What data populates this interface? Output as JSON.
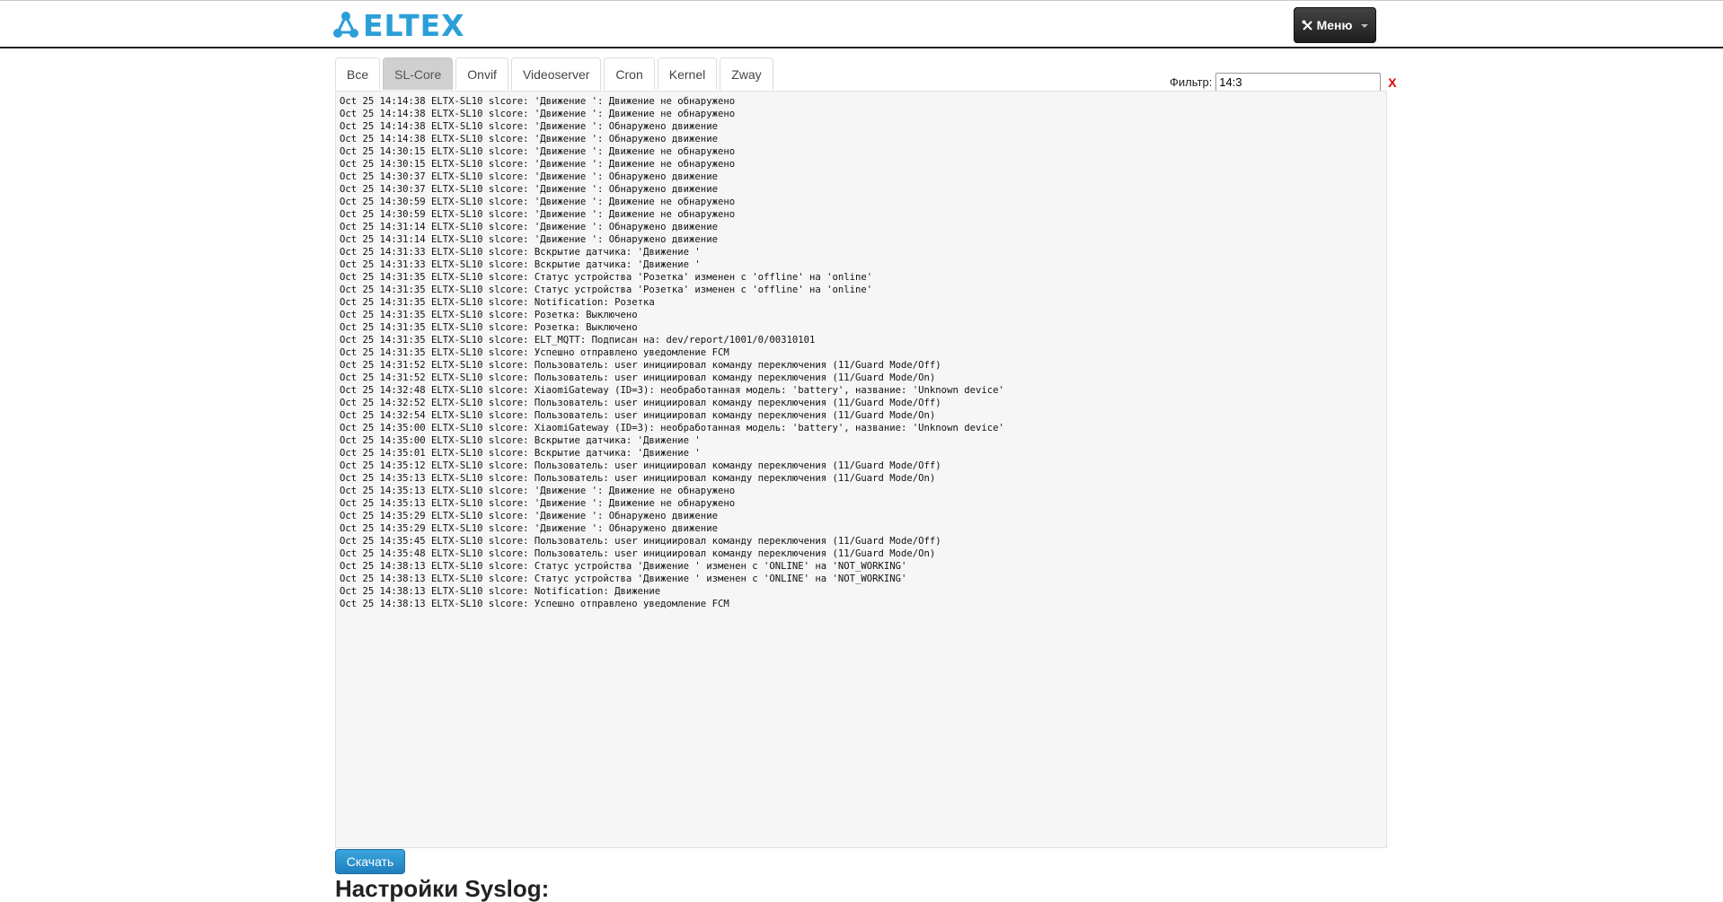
{
  "header": {
    "logo_text": "ELTEX",
    "menu_label": "Меню",
    "menu_icon": "tools-icon",
    "colors": {
      "brand": "#2b9fd8",
      "navbar_border": "#222222"
    }
  },
  "tabs": [
    {
      "label": "Все",
      "active": false
    },
    {
      "label": "SL-Core",
      "active": true
    },
    {
      "label": "Onvif",
      "active": false
    },
    {
      "label": "Videoserver",
      "active": false
    },
    {
      "label": "Cron",
      "active": false
    },
    {
      "label": "Kernel",
      "active": false
    },
    {
      "label": "Zway",
      "active": false
    }
  ],
  "filter": {
    "label": "Фильтр:",
    "value": "14:3",
    "clear_label": "X"
  },
  "log_lines": [
    "Oct 25 14:14:38 ELTX-SL10 slcore: 'Движение ': Движение не обнаружено",
    "Oct 25 14:14:38 ELTX-SL10 slcore: 'Движение ': Движение не обнаружено",
    "Oct 25 14:14:38 ELTX-SL10 slcore: 'Движение ': Обнаружено движение",
    "Oct 25 14:14:38 ELTX-SL10 slcore: 'Движение ': Обнаружено движение",
    "Oct 25 14:30:15 ELTX-SL10 slcore: 'Движение ': Движение не обнаружено",
    "Oct 25 14:30:15 ELTX-SL10 slcore: 'Движение ': Движение не обнаружено",
    "Oct 25 14:30:37 ELTX-SL10 slcore: 'Движение ': Обнаружено движение",
    "Oct 25 14:30:37 ELTX-SL10 slcore: 'Движение ': Обнаружено движение",
    "Oct 25 14:30:59 ELTX-SL10 slcore: 'Движение ': Движение не обнаружено",
    "Oct 25 14:30:59 ELTX-SL10 slcore: 'Движение ': Движение не обнаружено",
    "Oct 25 14:31:14 ELTX-SL10 slcore: 'Движение ': Обнаружено движение",
    "Oct 25 14:31:14 ELTX-SL10 slcore: 'Движение ': Обнаружено движение",
    "Oct 25 14:31:33 ELTX-SL10 slcore: Вскрытие датчика: 'Движение '",
    "Oct 25 14:31:33 ELTX-SL10 slcore: Вскрытие датчика: 'Движение '",
    "Oct 25 14:31:35 ELTX-SL10 slcore: Статус устройства 'Розетка' изменен с 'offline' на 'online'",
    "Oct 25 14:31:35 ELTX-SL10 slcore: Статус устройства 'Розетка' изменен с 'offline' на 'online'",
    "Oct 25 14:31:35 ELTX-SL10 slcore: Notification: Розетка",
    "Oct 25 14:31:35 ELTX-SL10 slcore: Розетка: Выключено",
    "Oct 25 14:31:35 ELTX-SL10 slcore: Розетка: Выключено",
    "Oct 25 14:31:35 ELTX-SL10 slcore: ELT_MQTT: Подписан на: dev/report/1001/0/00310101",
    "Oct 25 14:31:35 ELTX-SL10 slcore: Успешно отправлено уведомление FCM",
    "Oct 25 14:31:52 ELTX-SL10 slcore: Пользователь: user инициировал команду переключения (11/Guard Mode/Off)",
    "Oct 25 14:31:52 ELTX-SL10 slcore: Пользователь: user инициировал команду переключения (11/Guard Mode/On)",
    "Oct 25 14:32:48 ELTX-SL10 slcore: XiaomiGateway (ID=3): необработанная модель: 'battery', название: 'Unknown device'",
    "Oct 25 14:32:52 ELTX-SL10 slcore: Пользователь: user инициировал команду переключения (11/Guard Mode/Off)",
    "Oct 25 14:32:54 ELTX-SL10 slcore: Пользователь: user инициировал команду переключения (11/Guard Mode/On)",
    "Oct 25 14:35:00 ELTX-SL10 slcore: XiaomiGateway (ID=3): необработанная модель: 'battery', название: 'Unknown device'",
    "Oct 25 14:35:00 ELTX-SL10 slcore: Вскрытие датчика: 'Движение '",
    "Oct 25 14:35:01 ELTX-SL10 slcore: Вскрытие датчика: 'Движение '",
    "Oct 25 14:35:12 ELTX-SL10 slcore: Пользователь: user инициировал команду переключения (11/Guard Mode/Off)",
    "Oct 25 14:35:13 ELTX-SL10 slcore: Пользователь: user инициировал команду переключения (11/Guard Mode/On)",
    "Oct 25 14:35:13 ELTX-SL10 slcore: 'Движение ': Движение не обнаружено",
    "Oct 25 14:35:13 ELTX-SL10 slcore: 'Движение ': Движение не обнаружено",
    "Oct 25 14:35:29 ELTX-SL10 slcore: 'Движение ': Обнаружено движение",
    "Oct 25 14:35:29 ELTX-SL10 slcore: 'Движение ': Обнаружено движение",
    "Oct 25 14:35:45 ELTX-SL10 slcore: Пользователь: user инициировал команду переключения (11/Guard Mode/Off)",
    "Oct 25 14:35:48 ELTX-SL10 slcore: Пользователь: user инициировал команду переключения (11/Guard Mode/On)",
    "Oct 25 14:38:13 ELTX-SL10 slcore: Статус устройства 'Движение ' изменен с 'ONLINE' на 'NOT_WORKING'",
    "Oct 25 14:38:13 ELTX-SL10 slcore: Статус устройства 'Движение ' изменен с 'ONLINE' на 'NOT_WORKING'",
    "Oct 25 14:38:13 ELTX-SL10 slcore: Notification: Движение",
    "Oct 25 14:38:13 ELTX-SL10 slcore: Успешно отправлено уведомление FCM"
  ],
  "download_label": "Скачать",
  "section_title": "Настройки Syslog:"
}
